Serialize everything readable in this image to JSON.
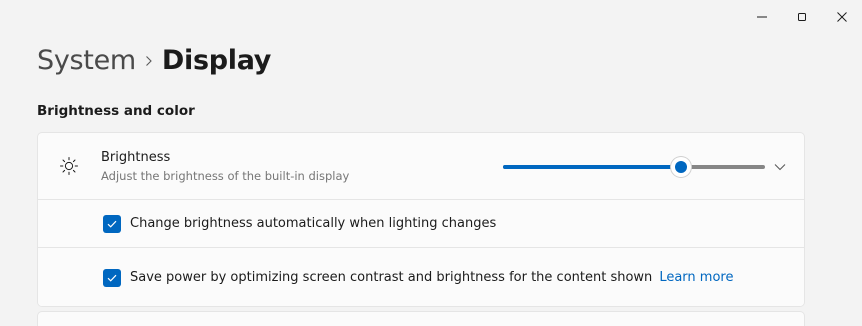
{
  "window": {
    "caption_buttons": [
      {
        "name": "minimize-icon"
      },
      {
        "name": "maximize-icon"
      },
      {
        "name": "close-icon"
      }
    ]
  },
  "breadcrumb": {
    "root": "System",
    "current": "Display",
    "separator_icon": "chevron-right-icon"
  },
  "section": {
    "title": "Brightness and color"
  },
  "brightness": {
    "icon": "brightness-sun-icon",
    "title": "Brightness",
    "description": "Adjust the brightness of the built-in display",
    "value_percent": 68,
    "expand_icon": "chevron-down-icon"
  },
  "options": {
    "auto_brightness": {
      "label": "Change brightness automatically when lighting changes",
      "checked": true
    },
    "content_adaptive": {
      "label": "Save power by optimizing screen contrast and brightness for the content shown",
      "checked": true,
      "link": "Learn more"
    }
  },
  "colors": {
    "accent": "#0067c0",
    "background": "#f3f3f3",
    "card": "#fbfbfb",
    "secondary_text": "#767676"
  }
}
